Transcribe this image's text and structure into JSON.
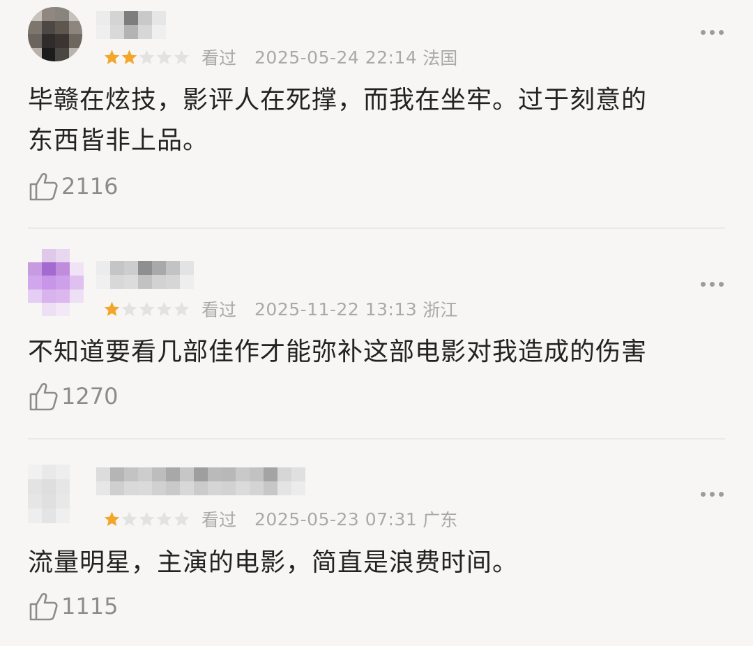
{
  "reviews": [
    {
      "rating": 2,
      "status": "看过",
      "date": "2025-05-24 22:14",
      "location": "法国",
      "content_line1": "毕赣在炫技，影评人在死撑，而我在坐牢。过于刻意的",
      "content_line2": "东西皆非上品。",
      "likes": "2116"
    },
    {
      "rating": 1,
      "status": "看过",
      "date": "2025-11-22 13:13",
      "location": "浙江",
      "content_line1": "不知道要看几部佳作才能弥补这部电影对我造成的伤害",
      "content_line2": "",
      "likes": "1270"
    },
    {
      "rating": 1,
      "status": "看过",
      "date": "2025-05-23 07:31",
      "location": "广东",
      "content_line1": "流量明星，主演的电影，简直是浪费时间。",
      "content_line2": "",
      "likes": "1115"
    }
  ],
  "colors": {
    "star_filled": "#f4a62a",
    "star_empty": "#e2e2e2",
    "meta_text": "#a9a9a9",
    "like_text": "#8b8b8b",
    "background": "#f7f6f4"
  },
  "icons": {
    "like": "thumbs-up-icon",
    "more": "more-dots-icon",
    "star": "star-icon"
  }
}
